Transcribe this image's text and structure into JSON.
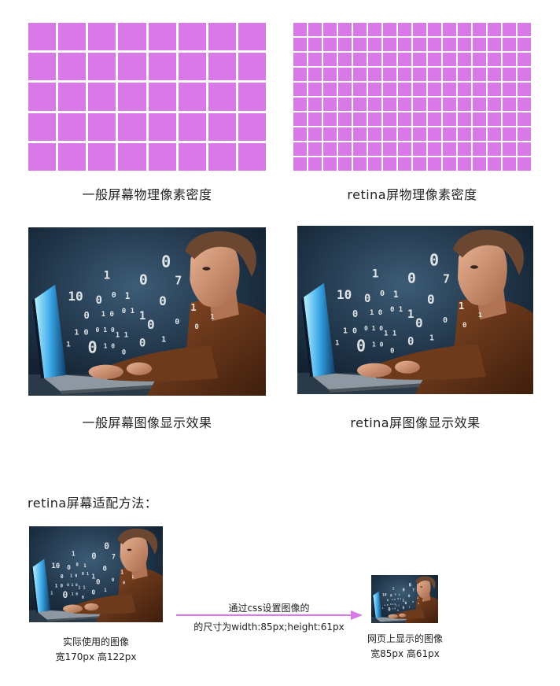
{
  "grids": {
    "normal": {
      "caption": "一般屏幕物理像素密度",
      "cols": 8,
      "rows": 5,
      "color": "#d979e8"
    },
    "retina": {
      "caption": "retina屏物理像素密度",
      "cols": 16,
      "rows": 10,
      "color": "#d979e8"
    }
  },
  "images": {
    "normal_caption": "一般屏幕图像显示效果",
    "retina_caption": "retina屏图像显示效果"
  },
  "method": {
    "heading": "retina屏幕适配方法：",
    "source": {
      "line1": "实际使用的图像",
      "line2": "宽170px  高122px"
    },
    "arrow": {
      "line1": "通过css设置图像的",
      "line2": "的尺寸为width:85px;height:61px",
      "color": "#d979e8"
    },
    "result": {
      "line1": "网页上显示的图像",
      "line2": "宽85px  高61px"
    }
  }
}
